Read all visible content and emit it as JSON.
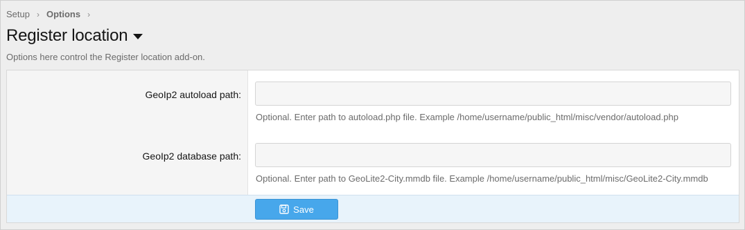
{
  "breadcrumb": {
    "items": [
      "Setup",
      "Options"
    ],
    "separator": "›"
  },
  "header": {
    "title": "Register location",
    "description": "Options here control the Register location add-on."
  },
  "form": {
    "fields": [
      {
        "label": "GeoIp2 autoload path:",
        "value": "",
        "explain": "Optional. Enter path to autoload.php file. Example /home/username/public_html/misc/vendor/autoload.php"
      },
      {
        "label": "GeoIp2 database path:",
        "value": "",
        "explain": "Optional. Enter path to GeoLite2-City.mmdb file. Example /home/username/public_html/misc/GeoLite2-City.mmdb"
      }
    ],
    "save_label": "Save",
    "save_icon": "save-icon"
  },
  "colors": {
    "accent": "#47a7eb",
    "footer_bg": "#e8f3fb",
    "page_bg": "#eeeeee"
  }
}
